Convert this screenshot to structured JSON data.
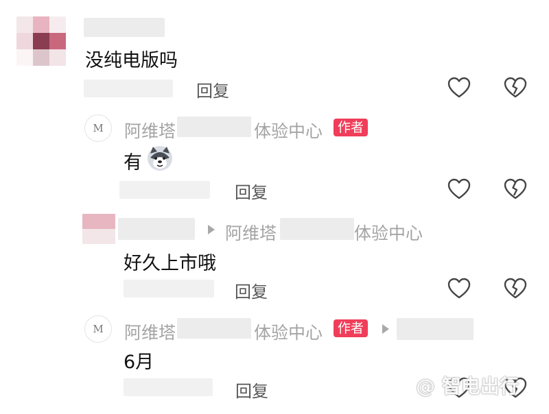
{
  "comments": [
    {
      "id": "c1",
      "avatar": "pixelated-avatar",
      "username": "",
      "text": "没纯电版吗",
      "reply_label": "回复"
    },
    {
      "id": "c2",
      "avatar": "avatr-logo",
      "avatar_text": "M",
      "username_prefix": "阿维塔",
      "username_suffix": "体验中心",
      "badge": "作者",
      "text": "有",
      "emoji": "husky-dog-emoji",
      "reply_label": "回复"
    },
    {
      "id": "c3",
      "avatar": "pixelated-avatar",
      "reply_to_prefix": "阿维塔",
      "reply_to_suffix": "体验中心",
      "text": "好久上市哦",
      "reply_label": "回复"
    },
    {
      "id": "c4",
      "avatar": "avatr-logo",
      "avatar_text": "M",
      "username_prefix": "阿维塔",
      "username_suffix": "体验中心",
      "badge": "作者",
      "text": "6月",
      "reply_label": "回复"
    }
  ],
  "watermark": "@ 智电出行",
  "icons": {
    "like": "heart-outline-icon",
    "dislike": "broken-heart-icon",
    "reply_arrow": "triangle-right-icon"
  },
  "colors": {
    "badge": "#f03e5a",
    "username": "#a4a4a4",
    "reply": "#555555"
  }
}
